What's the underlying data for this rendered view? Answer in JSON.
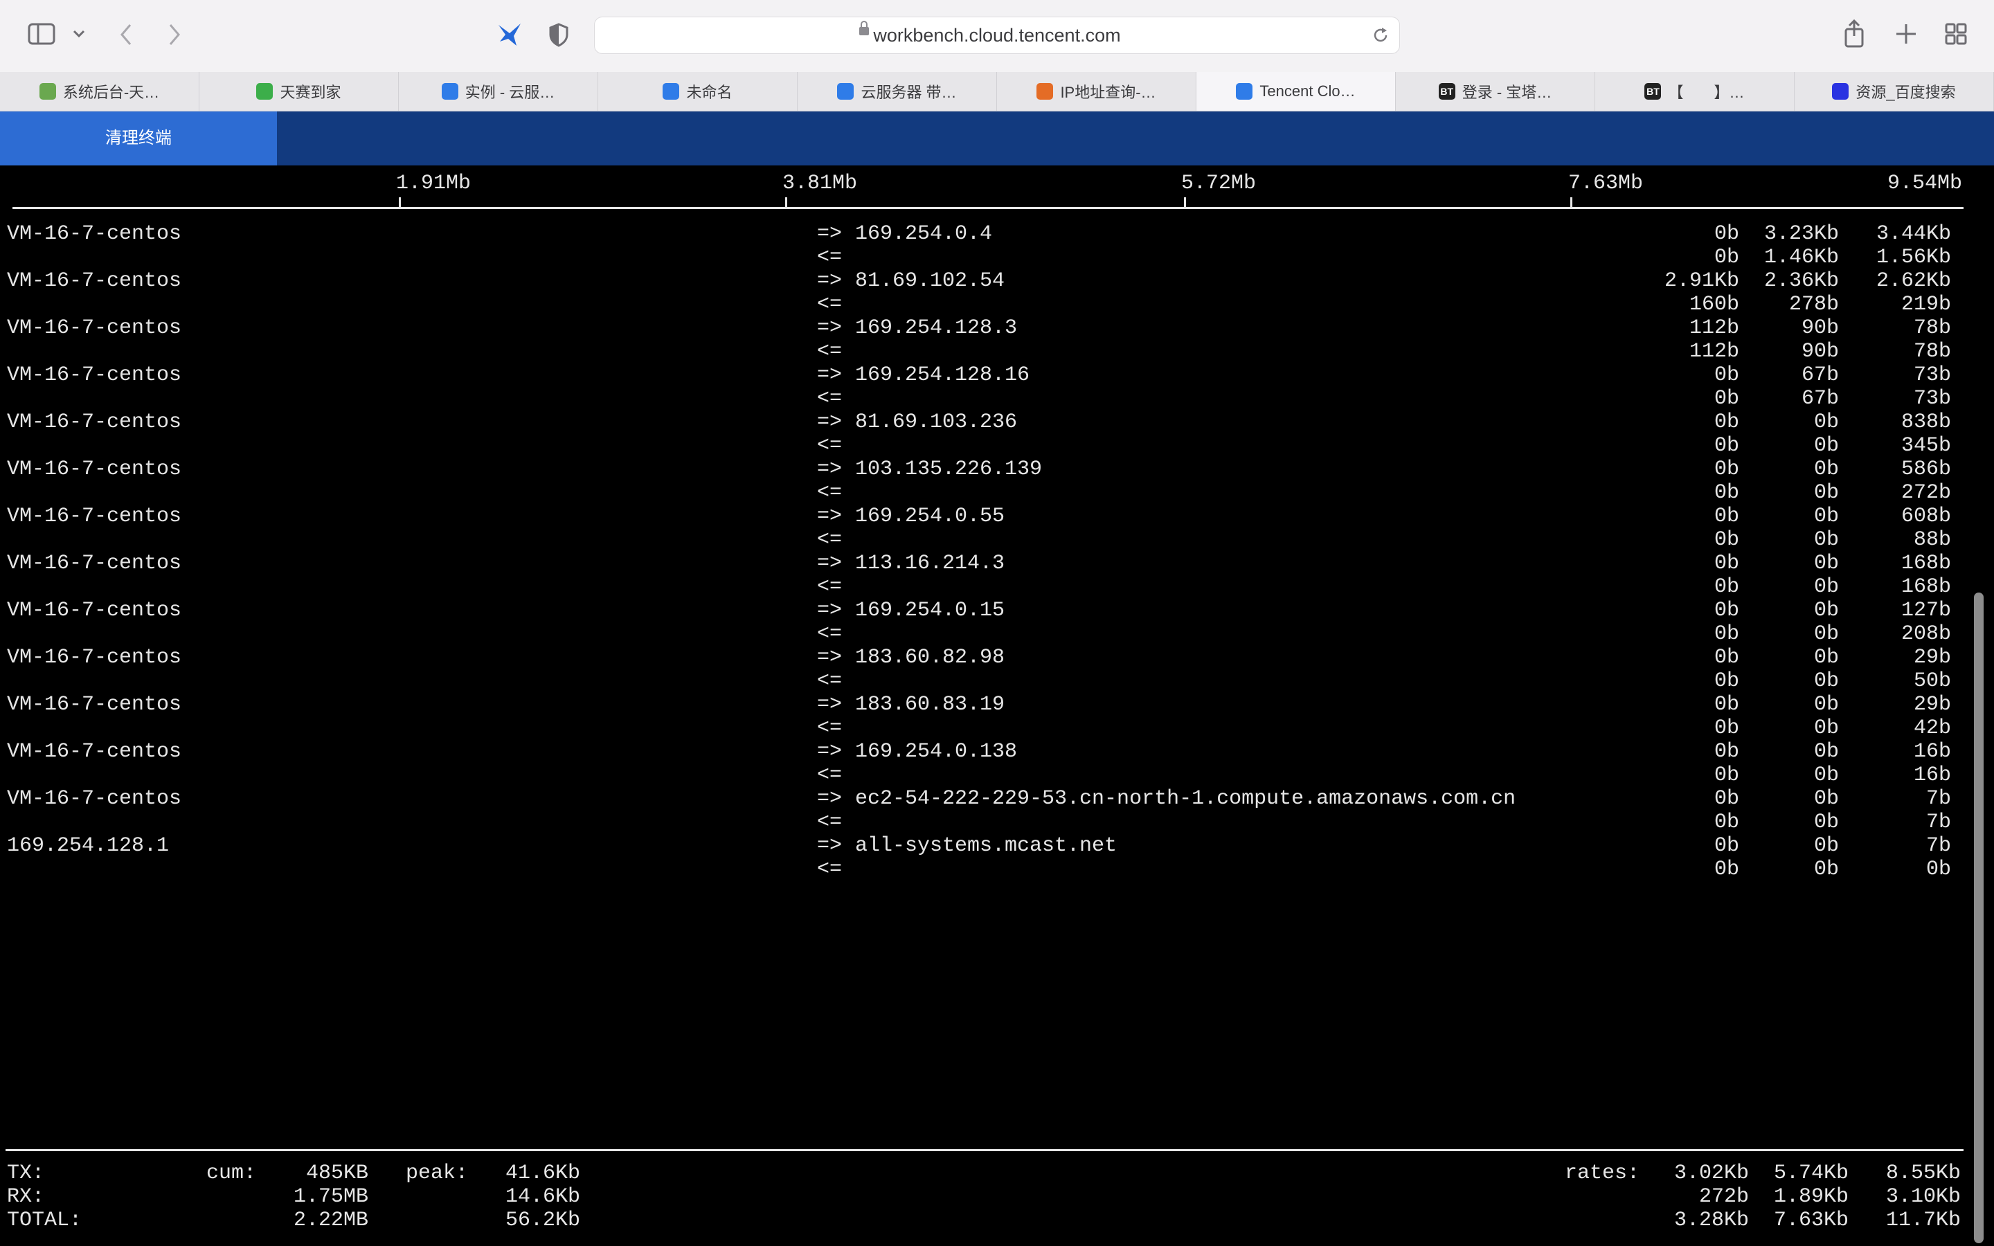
{
  "browser": {
    "url": "workbench.cloud.tencent.com",
    "tabs": [
      {
        "label": "系统后台-天…",
        "icon_color": "#6aa84f"
      },
      {
        "label": "天赛到家",
        "icon_color": "#3cae4a"
      },
      {
        "label": "实例 - 云服…",
        "icon_color": "#2f7ce8"
      },
      {
        "label": "未命名",
        "icon_color": "#2f7ce8"
      },
      {
        "label": "云服务器 带…",
        "icon_color": "#2f7ce8"
      },
      {
        "label": "IP地址查询-…",
        "icon_color": "#e46c26"
      },
      {
        "label": "Tencent Clo…",
        "icon_color": "#2f7ce8",
        "active": true
      },
      {
        "label": "登录 - 宝塔…",
        "icon_color": "#222222",
        "icon_text": "BT"
      },
      {
        "label": "【　　】…",
        "icon_color": "#222222",
        "icon_text": "BT"
      },
      {
        "label": "资源_百度搜索",
        "icon_color": "#2932e1"
      }
    ]
  },
  "console": {
    "clear_label": "清理终端"
  },
  "terminal": {
    "scale": [
      "1.91Mb",
      "3.81Mb",
      "5.72Mb",
      "7.63Mb",
      "9.54Mb"
    ],
    "connections": [
      {
        "src": "VM-16-7-centos",
        "dst": "169.254.0.4",
        "out": [
          "0b",
          "3.23Kb",
          "3.44Kb"
        ],
        "in": [
          "0b",
          "1.46Kb",
          "1.56Kb"
        ]
      },
      {
        "src": "VM-16-7-centos",
        "dst": "81.69.102.54",
        "out": [
          "2.91Kb",
          "2.36Kb",
          "2.62Kb"
        ],
        "in": [
          "160b",
          "278b",
          "219b"
        ]
      },
      {
        "src": "VM-16-7-centos",
        "dst": "169.254.128.3",
        "out": [
          "112b",
          "90b",
          "78b"
        ],
        "in": [
          "112b",
          "90b",
          "78b"
        ]
      },
      {
        "src": "VM-16-7-centos",
        "dst": "169.254.128.16",
        "out": [
          "0b",
          "67b",
          "73b"
        ],
        "in": [
          "0b",
          "67b",
          "73b"
        ]
      },
      {
        "src": "VM-16-7-centos",
        "dst": "81.69.103.236",
        "out": [
          "0b",
          "0b",
          "838b"
        ],
        "in": [
          "0b",
          "0b",
          "345b"
        ]
      },
      {
        "src": "VM-16-7-centos",
        "dst": "103.135.226.139",
        "out": [
          "0b",
          "0b",
          "586b"
        ],
        "in": [
          "0b",
          "0b",
          "272b"
        ]
      },
      {
        "src": "VM-16-7-centos",
        "dst": "169.254.0.55",
        "out": [
          "0b",
          "0b",
          "608b"
        ],
        "in": [
          "0b",
          "0b",
          "88b"
        ]
      },
      {
        "src": "VM-16-7-centos",
        "dst": "113.16.214.3",
        "out": [
          "0b",
          "0b",
          "168b"
        ],
        "in": [
          "0b",
          "0b",
          "168b"
        ]
      },
      {
        "src": "VM-16-7-centos",
        "dst": "169.254.0.15",
        "out": [
          "0b",
          "0b",
          "127b"
        ],
        "in": [
          "0b",
          "0b",
          "208b"
        ]
      },
      {
        "src": "VM-16-7-centos",
        "dst": "183.60.82.98",
        "out": [
          "0b",
          "0b",
          "29b"
        ],
        "in": [
          "0b",
          "0b",
          "50b"
        ]
      },
      {
        "src": "VM-16-7-centos",
        "dst": "183.60.83.19",
        "out": [
          "0b",
          "0b",
          "29b"
        ],
        "in": [
          "0b",
          "0b",
          "42b"
        ]
      },
      {
        "src": "VM-16-7-centos",
        "dst": "169.254.0.138",
        "out": [
          "0b",
          "0b",
          "16b"
        ],
        "in": [
          "0b",
          "0b",
          "16b"
        ]
      },
      {
        "src": "VM-16-7-centos",
        "dst": "ec2-54-222-229-53.cn-north-1.compute.amazonaws.com.cn",
        "out": [
          "0b",
          "0b",
          "7b"
        ],
        "in": [
          "0b",
          "0b",
          "7b"
        ]
      },
      {
        "src": "169.254.128.1",
        "dst": "all-systems.mcast.net",
        "out": [
          "0b",
          "0b",
          "7b"
        ],
        "in": [
          "0b",
          "0b",
          "0b"
        ]
      }
    ],
    "out_arrow": "=>",
    "in_arrow": "<=",
    "labels": {
      "cum": "cum:",
      "peak": "peak:",
      "rates": "rates:"
    },
    "totals": [
      {
        "label": "TX:",
        "cum": "485KB",
        "peak": "41.6Kb",
        "rates": [
          "3.02Kb",
          "5.74Kb",
          "8.55Kb"
        ]
      },
      {
        "label": "RX:",
        "cum": "1.75MB",
        "peak": "14.6Kb",
        "rates": [
          "272b",
          "1.89Kb",
          "3.10Kb"
        ]
      },
      {
        "label": "TOTAL:",
        "cum": "2.22MB",
        "peak": "56.2Kb",
        "rates": [
          "3.28Kb",
          "7.63Kb",
          "11.7Kb"
        ]
      }
    ]
  }
}
